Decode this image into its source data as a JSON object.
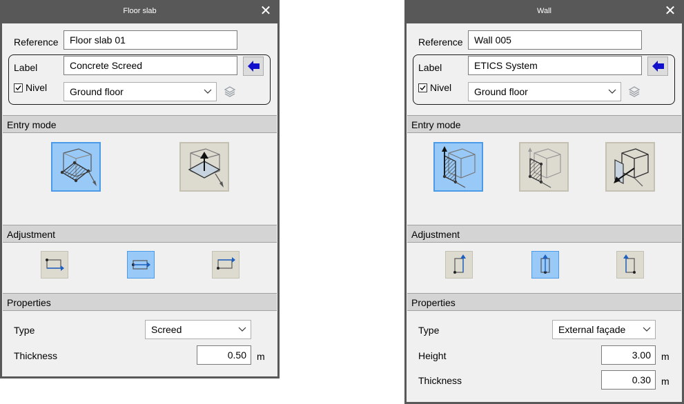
{
  "left_panel": {
    "title": "Floor slab",
    "close_glyph": "✕",
    "reference_label": "Reference",
    "reference_value": "Floor slab 01",
    "label_label": "Label",
    "label_value": "Concrete Screed",
    "nivel_label": "Nivel",
    "nivel_checked": true,
    "level_value": "Ground floor",
    "entry_mode_title": "Entry mode",
    "adjustment_title": "Adjustment",
    "properties_title": "Properties",
    "type_label": "Type",
    "type_value": "Screed",
    "thickness_label": "Thickness",
    "thickness_value": "0.50",
    "thickness_unit": "m",
    "entry_modes": [
      {
        "icon": "floor-slab-polygon-icon",
        "selected": true
      },
      {
        "icon": "floor-slab-extrude-icon",
        "selected": false
      }
    ],
    "adjustments": [
      {
        "icon": "align-top-arrow-icon",
        "selected": false
      },
      {
        "icon": "align-center-arrow-icon",
        "selected": true
      },
      {
        "icon": "align-bottom-arrow-icon",
        "selected": false
      }
    ]
  },
  "right_panel": {
    "title": "Wall",
    "close_glyph": "✕",
    "reference_label": "Reference",
    "reference_value": "Wall 005",
    "label_label": "Label",
    "label_value": "ETICS System",
    "nivel_label": "Nivel",
    "nivel_checked": true,
    "level_value": "Ground floor",
    "entry_mode_title": "Entry mode",
    "adjustment_title": "Adjustment",
    "properties_title": "Properties",
    "type_label": "Type",
    "type_value": "External façade",
    "height_label": "Height",
    "height_value": "3.00",
    "height_unit": "m",
    "thickness_label": "Thickness",
    "thickness_value": "0.30",
    "thickness_unit": "m",
    "entry_modes": [
      {
        "icon": "wall-polyline-icon",
        "selected": true
      },
      {
        "icon": "wall-face-icon",
        "selected": false
      },
      {
        "icon": "wall-room-icon",
        "selected": false
      }
    ],
    "adjustments": [
      {
        "icon": "wall-align-left-icon",
        "selected": false
      },
      {
        "icon": "wall-align-center-icon",
        "selected": true
      },
      {
        "icon": "wall-align-right-icon",
        "selected": false
      }
    ]
  },
  "colors": {
    "title_bar": "#585858",
    "panel_bg": "#f0f0f0",
    "selected_fill": "#99c9f7",
    "selected_border": "#4a9ae8",
    "unselected_fill": "#dddad0",
    "arrow_blue": "#1010cc"
  }
}
